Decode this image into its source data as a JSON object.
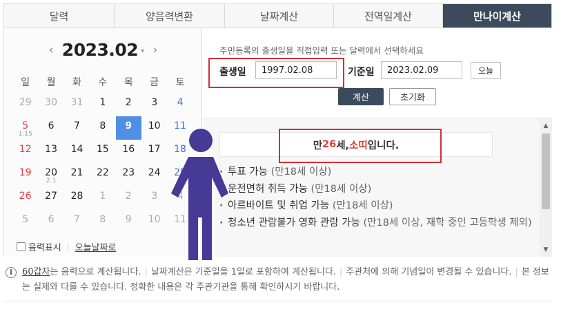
{
  "tabs": [
    {
      "label": "달력",
      "active": false
    },
    {
      "label": "양음력변환",
      "active": false
    },
    {
      "label": "날짜계산",
      "active": false
    },
    {
      "label": "전역일계산",
      "active": false
    },
    {
      "label": "만나이계산",
      "active": true
    }
  ],
  "calendar": {
    "title": "2023.02",
    "prev": "‹",
    "next": "›",
    "caret": "▾",
    "weekdays": [
      "일",
      "월",
      "화",
      "수",
      "목",
      "금",
      "토"
    ],
    "weeks": [
      [
        {
          "d": "29",
          "o": true
        },
        {
          "d": "30",
          "o": true
        },
        {
          "d": "31",
          "o": true
        },
        {
          "d": "1"
        },
        {
          "d": "2"
        },
        {
          "d": "3"
        },
        {
          "d": "4"
        }
      ],
      [
        {
          "d": "5",
          "l": "1.15"
        },
        {
          "d": "6"
        },
        {
          "d": "7"
        },
        {
          "d": "8"
        },
        {
          "d": "9",
          "t": true
        },
        {
          "d": "10"
        },
        {
          "d": "11"
        }
      ],
      [
        {
          "d": "12"
        },
        {
          "d": "13"
        },
        {
          "d": "14"
        },
        {
          "d": "15"
        },
        {
          "d": "16"
        },
        {
          "d": "17"
        },
        {
          "d": "18"
        }
      ],
      [
        {
          "d": "19"
        },
        {
          "d": "20",
          "l": "2.1"
        },
        {
          "d": "21"
        },
        {
          "d": "22"
        },
        {
          "d": "23"
        },
        {
          "d": "24"
        },
        {
          "d": "25"
        }
      ],
      [
        {
          "d": "26"
        },
        {
          "d": "27"
        },
        {
          "d": "28"
        },
        {
          "d": "1",
          "o": true
        },
        {
          "d": "2",
          "o": true
        },
        {
          "d": "3",
          "o": true
        },
        {
          "d": "4",
          "o": true
        }
      ],
      [
        {
          "d": "5",
          "o": true
        },
        {
          "d": "6",
          "o": true
        },
        {
          "d": "7",
          "o": true
        },
        {
          "d": "8",
          "o": true
        },
        {
          "d": "9",
          "o": true
        },
        {
          "d": "10",
          "o": true
        },
        {
          "d": "11",
          "o": true
        }
      ]
    ],
    "lunar_toggle": "음력표시",
    "today_link": "오늘날짜로"
  },
  "form": {
    "guide": "주민등록의 출생일을 직접입력 또는 달력에서 선택하세요",
    "birth_label": "출생일",
    "birth_value": "1997.02.08",
    "base_label": "기준일",
    "base_value": "2023.02.09",
    "today_button": "오늘",
    "calc_button": "계산",
    "reset_button": "초기화"
  },
  "result": {
    "prefix": "만 ",
    "age": "26",
    "age_unit": "세, ",
    "zodiac": "소띠",
    "suffix": " 입니다.",
    "items": [
      {
        "main": "투표 가능",
        "sub": " (만18세 이상)"
      },
      {
        "main": "운전면허 취득 가능",
        "sub": " (만18세 이상)"
      },
      {
        "main": "아르바이트 및 취업 가능",
        "sub": " (만18세 이상)"
      },
      {
        "main": "청소년 관람불가 영화 관람 가능",
        "sub": " (만18세 이상, 재학 중인 고등학생 제외)"
      }
    ]
  },
  "note": {
    "term": "60갑자",
    "text1": "는 음력으로 계산됩니다.",
    "text2": "날짜계산은 기준일을 1일로 포함하여 계산됩니다.",
    "text3": "주관처에 의해 기념일이 변경될 수 있습니다.",
    "text4": "본 정보는 실제와 다를 수 있습니다. 정확한 내용은 각 주관기관을 통해 확인하시기 바랍니다."
  },
  "colors": {
    "accent": "#3b4a5c",
    "today": "#4f8fe6",
    "highlight": "#e03c3c",
    "figure": "#463a96"
  }
}
